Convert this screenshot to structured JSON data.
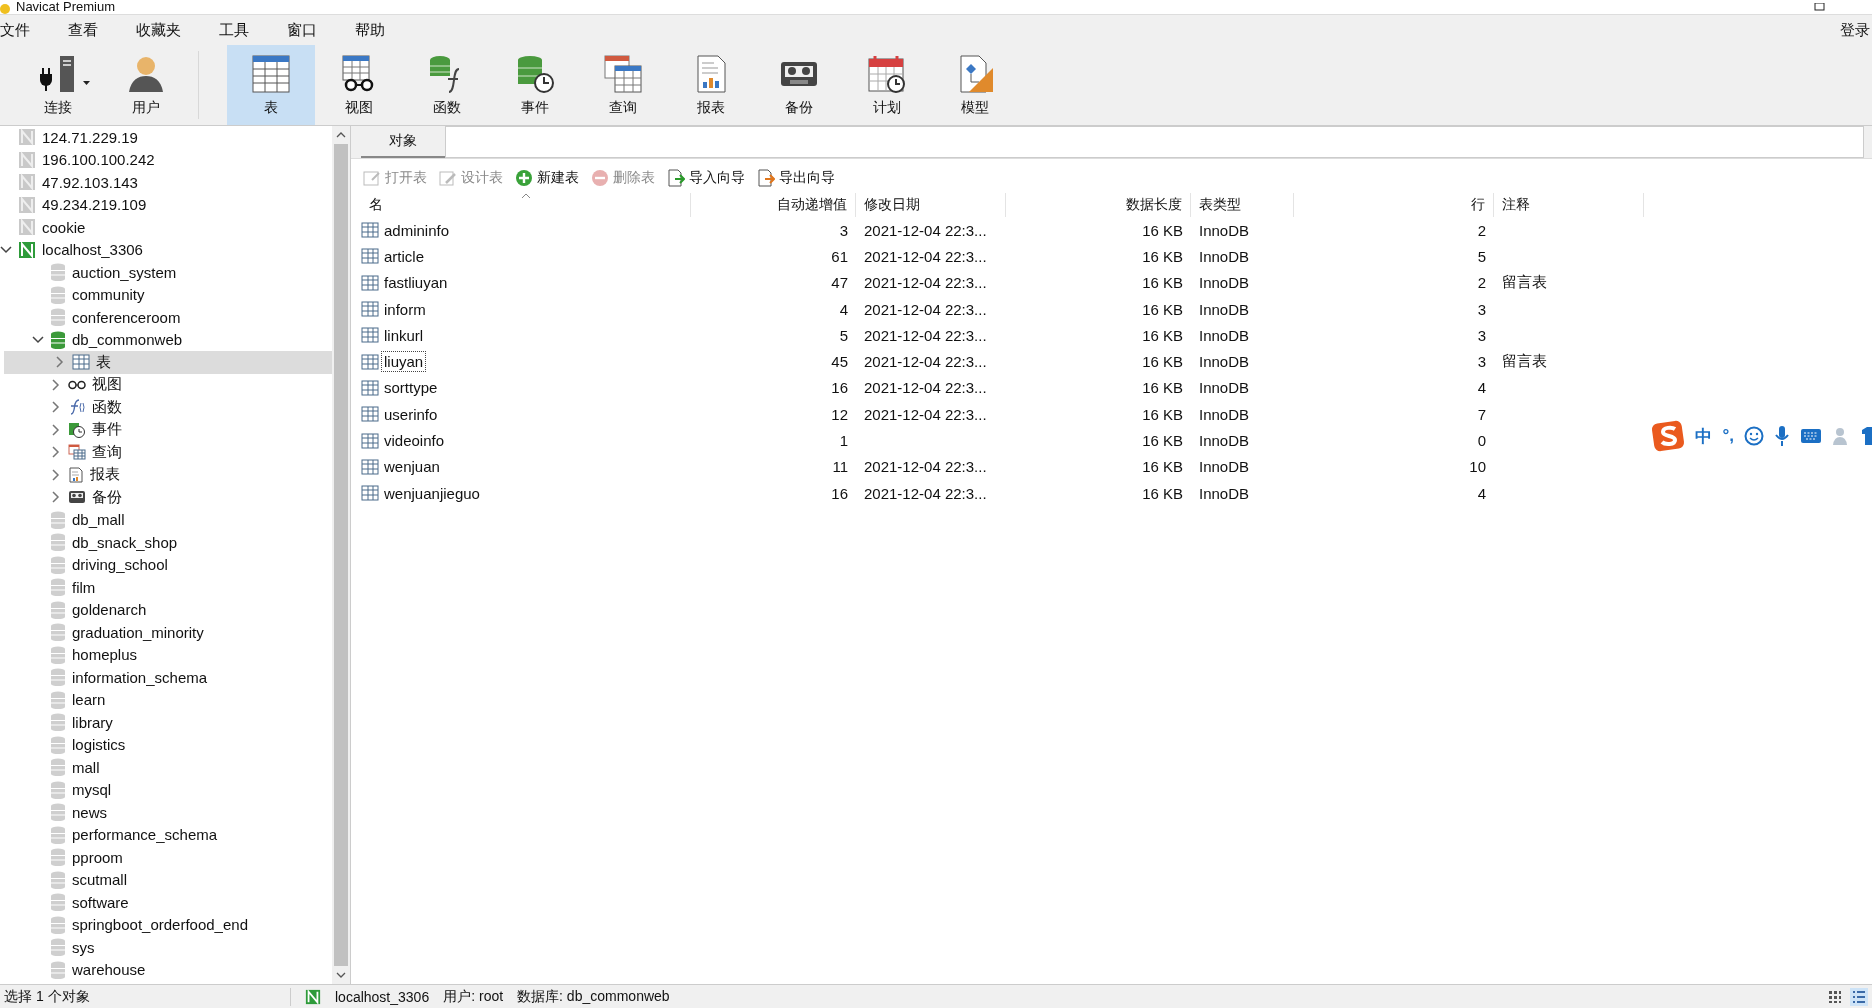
{
  "window": {
    "title": "Navicat Premium"
  },
  "menu": [
    "文件",
    "查看",
    "收藏夹",
    "工具",
    "窗口",
    "帮助"
  ],
  "login": "登录",
  "toolbar": [
    {
      "kind": "connect",
      "label": "连接",
      "selected": false,
      "dropdown": true
    },
    {
      "kind": "user",
      "label": "用户",
      "selected": false
    },
    {
      "kind": "table",
      "label": "表",
      "selected": true,
      "group_start": true
    },
    {
      "kind": "view",
      "label": "视图",
      "selected": false
    },
    {
      "kind": "function",
      "label": "函数",
      "selected": false
    },
    {
      "kind": "event",
      "label": "事件",
      "selected": false
    },
    {
      "kind": "query",
      "label": "查询",
      "selected": false
    },
    {
      "kind": "report",
      "label": "报表",
      "selected": false
    },
    {
      "kind": "backup",
      "label": "备份",
      "selected": false
    },
    {
      "kind": "schedule",
      "label": "计划",
      "selected": false
    },
    {
      "kind": "model",
      "label": "模型",
      "selected": false
    }
  ],
  "sidebar": {
    "items": [
      {
        "kind": "connection",
        "name": "124.71.229.19",
        "open": false,
        "selected": false
      },
      {
        "kind": "connection",
        "name": "196.100.100.242",
        "open": false,
        "selected": false
      },
      {
        "kind": "connection",
        "name": "47.92.103.143",
        "open": false,
        "selected": false
      },
      {
        "kind": "connection",
        "name": "49.234.219.109",
        "open": false,
        "selected": false
      },
      {
        "kind": "connection",
        "name": "cookie",
        "open": false,
        "selected": false
      },
      {
        "kind": "connection",
        "name": "localhost_3306",
        "open": true,
        "selected": false,
        "expanded": true,
        "children": [
          {
            "kind": "database",
            "name": "auction_system",
            "open": false,
            "selected": false
          },
          {
            "kind": "database",
            "name": "community",
            "open": false,
            "selected": false
          },
          {
            "kind": "database",
            "name": "conferenceroom",
            "open": false,
            "selected": false
          },
          {
            "kind": "database",
            "name": "db_commonweb",
            "open": true,
            "selected": false,
            "expanded": true,
            "children": [
              {
                "kind": "table",
                "name": "表",
                "selected": true,
                "expanded": false
              },
              {
                "kind": "view",
                "name": "视图",
                "selected": false,
                "expanded": false
              },
              {
                "kind": "function",
                "name": "函数",
                "selected": false,
                "expanded": false
              },
              {
                "kind": "event",
                "name": "事件",
                "selected": false,
                "expanded": false
              },
              {
                "kind": "query",
                "name": "查询",
                "selected": false,
                "expanded": false
              },
              {
                "kind": "report",
                "name": "报表",
                "selected": false,
                "expanded": false
              },
              {
                "kind": "backup",
                "name": "备份",
                "selected": false,
                "expanded": false
              }
            ]
          },
          {
            "kind": "database",
            "name": "db_mall",
            "open": false,
            "selected": false
          },
          {
            "kind": "database",
            "name": "db_snack_shop",
            "open": false,
            "selected": false
          },
          {
            "kind": "database",
            "name": "driving_school",
            "open": false,
            "selected": false
          },
          {
            "kind": "database",
            "name": "film",
            "open": false,
            "selected": false
          },
          {
            "kind": "database",
            "name": "goldenarch",
            "open": false,
            "selected": false
          },
          {
            "kind": "database",
            "name": "graduation_minority",
            "open": false,
            "selected": false
          },
          {
            "kind": "database",
            "name": "homeplus",
            "open": false,
            "selected": false
          },
          {
            "kind": "database",
            "name": "information_schema",
            "open": false,
            "selected": false
          },
          {
            "kind": "database",
            "name": "learn",
            "open": false,
            "selected": false
          },
          {
            "kind": "database",
            "name": "library",
            "open": false,
            "selected": false
          },
          {
            "kind": "database",
            "name": "logistics",
            "open": false,
            "selected": false
          },
          {
            "kind": "database",
            "name": "mall",
            "open": false,
            "selected": false
          },
          {
            "kind": "database",
            "name": "mysql",
            "open": false,
            "selected": false
          },
          {
            "kind": "database",
            "name": "news",
            "open": false,
            "selected": false
          },
          {
            "kind": "database",
            "name": "performance_schema",
            "open": false,
            "selected": false
          },
          {
            "kind": "database",
            "name": "pproom",
            "open": false,
            "selected": false
          },
          {
            "kind": "database",
            "name": "scutmall",
            "open": false,
            "selected": false
          },
          {
            "kind": "database",
            "name": "software",
            "open": false,
            "selected": false
          },
          {
            "kind": "database",
            "name": "springboot_orderfood_end",
            "open": false,
            "selected": false
          },
          {
            "kind": "database",
            "name": "sys",
            "open": false,
            "selected": false
          },
          {
            "kind": "database",
            "name": "warehouse",
            "open": false,
            "selected": false
          }
        ]
      }
    ]
  },
  "tabs": [
    {
      "label": "对象",
      "selected": true
    }
  ],
  "actions": [
    {
      "kind": "open",
      "label": "打开表",
      "disabled": true
    },
    {
      "kind": "design",
      "label": "设计表",
      "disabled": true
    },
    {
      "kind": "new",
      "label": "新建表",
      "disabled": false
    },
    {
      "kind": "delete",
      "label": "删除表",
      "disabled": true
    },
    {
      "kind": "import",
      "label": "导入向导",
      "disabled": false
    },
    {
      "kind": "export",
      "label": "导出向导",
      "disabled": false
    }
  ],
  "table": {
    "columns": [
      {
        "label": "名",
        "kind": "text"
      },
      {
        "label": "自动递增值",
        "kind": "number"
      },
      {
        "label": "修改日期",
        "kind": "text"
      },
      {
        "label": "数据长度",
        "kind": "number"
      },
      {
        "label": "表类型",
        "kind": "text"
      },
      {
        "label": "行",
        "kind": "number"
      },
      {
        "label": "注释",
        "kind": "text"
      }
    ],
    "rows": [
      {
        "focused": false,
        "cells": [
          "admininfo",
          "3",
          "2021-12-04 22:3...",
          "16 KB",
          "InnoDB",
          "2",
          ""
        ]
      },
      {
        "focused": false,
        "cells": [
          "article",
          "61",
          "2021-12-04 22:3...",
          "16 KB",
          "InnoDB",
          "5",
          ""
        ]
      },
      {
        "focused": false,
        "cells": [
          "fastliuyan",
          "47",
          "2021-12-04 22:3...",
          "16 KB",
          "InnoDB",
          "2",
          "留言表"
        ]
      },
      {
        "focused": false,
        "cells": [
          "inform",
          "4",
          "2021-12-04 22:3...",
          "16 KB",
          "InnoDB",
          "3",
          ""
        ]
      },
      {
        "focused": false,
        "cells": [
          "linkurl",
          "5",
          "2021-12-04 22:3...",
          "16 KB",
          "InnoDB",
          "3",
          ""
        ]
      },
      {
        "focused": true,
        "cells": [
          "liuyan",
          "45",
          "2021-12-04 22:3...",
          "16 KB",
          "InnoDB",
          "3",
          "留言表"
        ]
      },
      {
        "focused": false,
        "cells": [
          "sorttype",
          "16",
          "2021-12-04 22:3...",
          "16 KB",
          "InnoDB",
          "4",
          ""
        ]
      },
      {
        "focused": false,
        "cells": [
          "userinfo",
          "12",
          "2021-12-04 22:3...",
          "16 KB",
          "InnoDB",
          "7",
          ""
        ]
      },
      {
        "focused": false,
        "cells": [
          "videoinfo",
          "1",
          "",
          "16 KB",
          "InnoDB",
          "0",
          ""
        ]
      },
      {
        "focused": false,
        "cells": [
          "wenjuan",
          "11",
          "2021-12-04 22:3...",
          "16 KB",
          "InnoDB",
          "10",
          ""
        ]
      },
      {
        "focused": false,
        "cells": [
          "wenjuanjieguo",
          "16",
          "2021-12-04 22:3...",
          "16 KB",
          "InnoDB",
          "4",
          ""
        ]
      }
    ]
  },
  "ime": {
    "mode": "中",
    "punct": "°,"
  },
  "status_bar": {
    "selection": "选择 1 个对象",
    "connection": "localhost_3306",
    "user": "用户: root",
    "database": "数据库: db_commonweb"
  }
}
